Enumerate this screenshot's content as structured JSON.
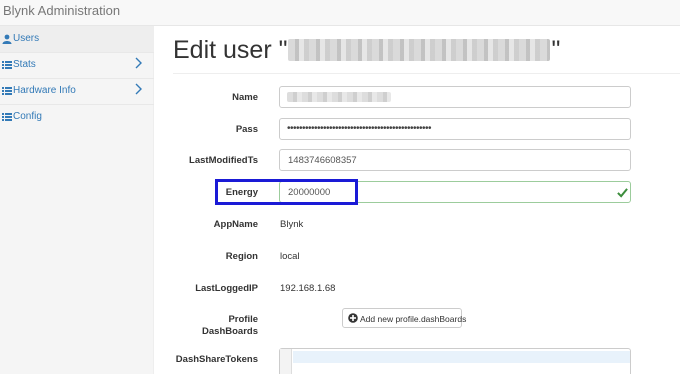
{
  "app": {
    "brand": "Blynk Administration"
  },
  "sidebar": {
    "items": [
      {
        "label": "Users",
        "icon": "user-icon",
        "active": true,
        "has_submenu": false
      },
      {
        "label": "Stats",
        "icon": "list-icon",
        "active": false,
        "has_submenu": true
      },
      {
        "label": "Hardware Info",
        "icon": "list-icon",
        "active": false,
        "has_submenu": true
      },
      {
        "label": "Config",
        "icon": "list-icon",
        "active": false,
        "has_submenu": false
      }
    ]
  },
  "page": {
    "title_prefix": "Edit user \"",
    "title_suffix": "\""
  },
  "form": {
    "name_label": "Name",
    "pass_label": "Pass",
    "pass_value": "••••••••••••••••••••••••••••••••••••••••••••••••",
    "last_modified_label": "LastModifiedTs",
    "last_modified_value": "1483746608357",
    "energy_label": "Energy",
    "energy_value": "20000000",
    "app_name_label": "AppName",
    "app_name_value": "Blynk",
    "region_label": "Region",
    "region_value": "local",
    "last_ip_label": "LastLoggedIP",
    "last_ip_value": "192.168.1.68",
    "profile_label_line1": "Profile",
    "profile_label_line2": "DashBoards",
    "add_dashboard_button": "Add new profile.dashBoards",
    "dash_share_tokens_label": "DashShareTokens"
  },
  "colors": {
    "link": "#337ab7",
    "highlight_border": "#1a1ad6",
    "success_check": "#3c8d3c"
  }
}
